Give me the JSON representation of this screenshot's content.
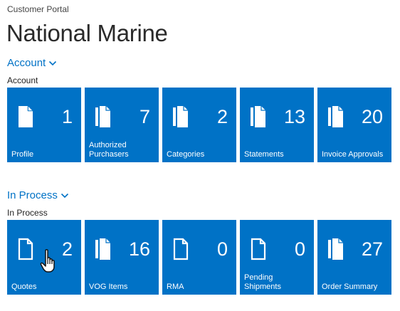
{
  "breadcrumb": "Customer Portal",
  "title": "National Marine",
  "colors": {
    "tile": "#0072c6",
    "link": "#0072c6"
  },
  "groups": [
    {
      "toggle_label": "Account",
      "label": "Account",
      "tiles": [
        {
          "label": "Profile",
          "count": "1",
          "icon": "single-document-icon"
        },
        {
          "label": "Authorized Purchasers",
          "count": "7",
          "icon": "documents-stack-icon"
        },
        {
          "label": "Categories",
          "count": "2",
          "icon": "documents-stack-icon"
        },
        {
          "label": "Statements",
          "count": "13",
          "icon": "documents-stack-icon"
        },
        {
          "label": "Invoice Approvals",
          "count": "20",
          "icon": "documents-stack-icon"
        }
      ]
    },
    {
      "toggle_label": "In Process",
      "label": "In Process",
      "tiles": [
        {
          "label": "Quotes",
          "count": "2",
          "icon": "outline-document-icon"
        },
        {
          "label": "VOG Items",
          "count": "16",
          "icon": "documents-stack-icon"
        },
        {
          "label": "RMA",
          "count": "0",
          "icon": "outline-document-icon"
        },
        {
          "label": "Pending Shipments",
          "count": "0",
          "icon": "outline-document-icon"
        },
        {
          "label": "Order Summary",
          "count": "27",
          "icon": "documents-stack-icon"
        }
      ]
    }
  ]
}
